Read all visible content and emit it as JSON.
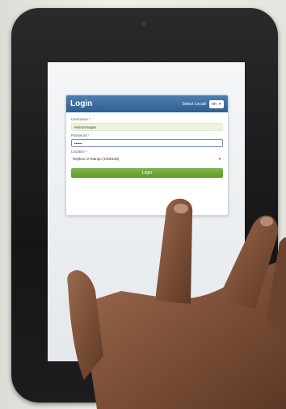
{
  "login": {
    "title": "Login",
    "language_label": "Select Locale",
    "language_value": "en",
    "username_label": "Username",
    "username_value": "emimcmuqan",
    "password_label": "Password",
    "password_value": "••••••",
    "location_label": "Location",
    "location_value": "Rajihun O Ratnpu (1000165)",
    "login_button": "Login"
  }
}
